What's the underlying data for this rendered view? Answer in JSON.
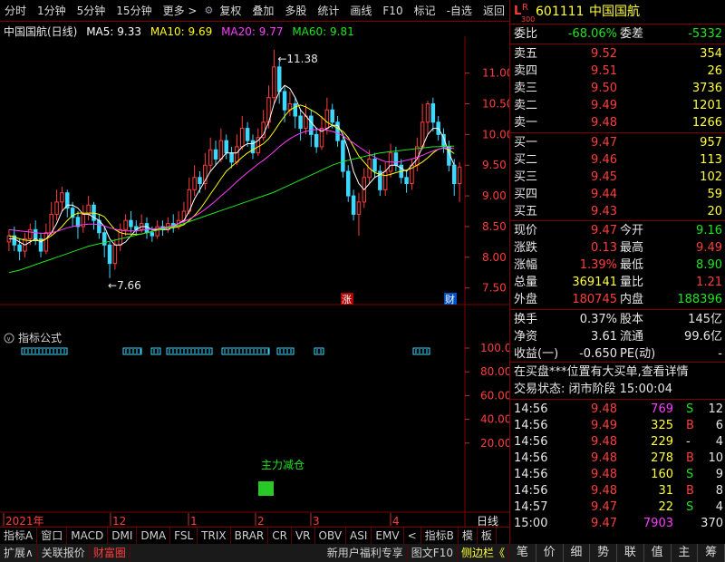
{
  "toolbar": {
    "left": [
      "分时",
      "1分钟",
      "5分钟",
      "15分钟",
      "更多 >"
    ],
    "right": [
      "复权",
      "叠加",
      "多股",
      "统计",
      "画线",
      "F10",
      "标记",
      "-自选",
      "返回"
    ]
  },
  "chart_header": {
    "name": "中国国航(日线)",
    "ma5": "MA5: 9.33",
    "ma10": "MA10: 9.69",
    "ma20": "MA20: 9.77",
    "ma60": "MA60: 9.81"
  },
  "colors": {
    "up": "#ff3c3c",
    "down": "#3cd8ff",
    "ma5": "#ffffff",
    "ma10": "#ffff00",
    "ma20": "#ff3cff",
    "ma60": "#1ee61e"
  },
  "chart_data": {
    "type": "candlestick",
    "y_ticks": [
      "11.00",
      "10.50",
      "10.00",
      "9.50",
      "9.00",
      "8.50",
      "8.00",
      "7.50"
    ],
    "ylim": [
      7.2,
      11.6
    ],
    "high_label": "11.38",
    "low_label": "7.66",
    "x_labels": [
      "2021年",
      "12",
      "1",
      "2",
      "3",
      "4"
    ],
    "candles": [
      [
        8.25,
        8.35,
        8.45,
        8.1
      ],
      [
        8.35,
        8.2,
        8.5,
        8.1
      ],
      [
        8.2,
        8.1,
        8.3,
        7.95
      ],
      [
        8.1,
        8.3,
        8.4,
        8.0
      ],
      [
        8.3,
        8.45,
        8.55,
        8.2
      ],
      [
        8.45,
        8.3,
        8.6,
        8.2
      ],
      [
        8.3,
        8.1,
        8.4,
        8.0
      ],
      [
        8.1,
        8.4,
        8.55,
        8.05
      ],
      [
        8.4,
        8.7,
        8.9,
        8.35
      ],
      [
        8.7,
        8.9,
        9.1,
        8.6
      ],
      [
        8.9,
        9.05,
        9.15,
        8.75
      ],
      [
        9.05,
        8.8,
        9.1,
        8.65
      ],
      [
        8.8,
        8.65,
        8.9,
        8.5
      ],
      [
        8.65,
        8.5,
        8.75,
        8.3
      ],
      [
        8.5,
        8.7,
        8.85,
        8.4
      ],
      [
        8.7,
        8.85,
        9.0,
        8.6
      ],
      [
        8.85,
        8.6,
        8.9,
        8.45
      ],
      [
        8.6,
        8.4,
        8.7,
        8.3
      ],
      [
        8.4,
        8.2,
        8.5,
        8.0
      ],
      [
        8.2,
        7.9,
        8.25,
        7.66
      ],
      [
        7.9,
        8.2,
        8.3,
        7.8
      ],
      [
        8.2,
        8.45,
        8.55,
        8.1
      ],
      [
        8.45,
        8.6,
        8.7,
        8.35
      ],
      [
        8.6,
        8.5,
        8.75,
        8.4
      ],
      [
        8.5,
        8.45,
        8.6,
        8.35
      ],
      [
        8.45,
        8.55,
        8.7,
        8.4
      ],
      [
        8.55,
        8.4,
        8.65,
        8.3
      ],
      [
        8.4,
        8.35,
        8.5,
        8.25
      ],
      [
        8.35,
        8.5,
        8.6,
        8.3
      ],
      [
        8.5,
        8.45,
        8.6,
        8.35
      ],
      [
        8.45,
        8.55,
        8.65,
        8.4
      ],
      [
        8.55,
        8.5,
        8.7,
        8.4
      ],
      [
        8.5,
        8.6,
        8.75,
        8.45
      ],
      [
        8.6,
        8.75,
        8.9,
        8.55
      ],
      [
        8.75,
        9.1,
        9.3,
        8.7
      ],
      [
        9.1,
        9.3,
        9.5,
        9.0
      ],
      [
        9.3,
        9.2,
        9.4,
        9.05
      ],
      [
        9.2,
        9.5,
        9.7,
        9.1
      ],
      [
        9.5,
        9.75,
        9.95,
        9.4
      ],
      [
        9.75,
        9.6,
        9.9,
        9.5
      ],
      [
        9.6,
        9.9,
        10.1,
        9.55
      ],
      [
        9.9,
        9.7,
        10.0,
        9.6
      ],
      [
        9.7,
        9.55,
        9.8,
        9.45
      ],
      [
        9.55,
        9.8,
        10.0,
        9.5
      ],
      [
        9.8,
        10.1,
        10.3,
        9.75
      ],
      [
        10.1,
        9.9,
        10.2,
        9.8
      ],
      [
        9.9,
        9.7,
        10.0,
        9.6
      ],
      [
        9.7,
        9.95,
        10.1,
        9.65
      ],
      [
        9.95,
        10.2,
        10.4,
        9.9
      ],
      [
        10.2,
        10.6,
        10.8,
        10.1
      ],
      [
        10.6,
        11.1,
        11.38,
        10.5
      ],
      [
        11.1,
        10.7,
        11.2,
        10.5
      ],
      [
        10.7,
        10.4,
        10.8,
        10.2
      ],
      [
        10.4,
        10.5,
        10.7,
        10.3
      ],
      [
        10.5,
        10.3,
        10.6,
        10.1
      ],
      [
        10.3,
        10.1,
        10.4,
        9.9
      ],
      [
        10.1,
        10.3,
        10.5,
        10.0
      ],
      [
        10.3,
        10.0,
        10.4,
        9.8
      ],
      [
        10.0,
        9.8,
        10.1,
        9.7
      ],
      [
        9.8,
        10.1,
        10.3,
        9.75
      ],
      [
        10.1,
        10.4,
        10.6,
        10.0
      ],
      [
        10.4,
        10.2,
        10.5,
        10.1
      ],
      [
        10.2,
        9.9,
        10.3,
        9.8
      ],
      [
        9.9,
        9.4,
        10.0,
        9.3
      ],
      [
        9.4,
        9.0,
        9.5,
        8.9
      ],
      [
        9.0,
        8.7,
        9.1,
        8.6
      ],
      [
        8.7,
        8.9,
        9.05,
        8.35
      ],
      [
        8.9,
        9.3,
        9.45,
        8.8
      ],
      [
        9.3,
        9.6,
        9.75,
        9.2
      ],
      [
        9.6,
        9.4,
        9.7,
        9.3
      ],
      [
        9.4,
        9.1,
        9.5,
        9.0
      ],
      [
        9.1,
        9.4,
        9.55,
        9.0
      ],
      [
        9.4,
        9.7,
        9.85,
        9.3
      ],
      [
        9.7,
        9.5,
        9.8,
        9.4
      ],
      [
        9.5,
        9.3,
        9.6,
        9.2
      ],
      [
        9.3,
        9.2,
        9.4,
        9.05
      ],
      [
        9.2,
        9.5,
        9.6,
        9.1
      ],
      [
        9.5,
        9.8,
        9.95,
        9.4
      ],
      [
        9.8,
        10.2,
        10.5,
        9.75
      ],
      [
        10.2,
        10.5,
        10.55,
        10.0
      ],
      [
        10.5,
        10.2,
        10.6,
        10.05
      ],
      [
        10.2,
        10.0,
        10.3,
        9.9
      ],
      [
        10.0,
        9.8,
        10.1,
        9.7
      ],
      [
        9.8,
        9.5,
        9.9,
        9.4
      ],
      [
        9.5,
        9.2,
        9.6,
        9.0
      ],
      [
        9.2,
        9.47,
        9.55,
        8.9
      ]
    ],
    "series": [
      {
        "name": "MA5",
        "values": [
          8.3,
          8.3,
          8.25,
          8.2,
          8.25,
          8.3,
          8.25,
          8.3,
          8.4,
          8.55,
          8.75,
          8.85,
          8.85,
          8.8,
          8.7,
          8.7,
          8.65,
          8.6,
          8.5,
          8.3,
          8.2,
          8.2,
          8.25,
          8.35,
          8.45,
          8.5,
          8.5,
          8.45,
          8.45,
          8.45,
          8.45,
          8.5,
          8.55,
          8.6,
          8.75,
          8.95,
          9.1,
          9.25,
          9.4,
          9.5,
          9.6,
          9.7,
          9.7,
          9.7,
          9.8,
          9.85,
          9.85,
          9.9,
          10.0,
          10.2,
          10.5,
          10.7,
          10.8,
          10.75,
          10.6,
          10.4,
          10.3,
          10.2,
          10.1,
          10.05,
          10.1,
          10.15,
          10.15,
          10.0,
          9.75,
          9.4,
          9.2,
          9.1,
          9.2,
          9.3,
          9.35,
          9.4,
          9.5,
          9.5,
          9.45,
          9.4,
          9.5,
          9.6,
          9.8,
          10.0,
          10.1,
          10.1,
          9.95,
          9.7,
          9.5
        ]
      },
      {
        "name": "MA10",
        "values": [
          8.35,
          8.33,
          8.3,
          8.28,
          8.27,
          8.27,
          8.27,
          8.3,
          8.35,
          8.42,
          8.5,
          8.6,
          8.68,
          8.72,
          8.72,
          8.72,
          8.72,
          8.7,
          8.66,
          8.55,
          8.45,
          8.4,
          8.38,
          8.38,
          8.37,
          8.38,
          8.4,
          8.42,
          8.45,
          8.47,
          8.48,
          8.48,
          8.5,
          8.53,
          8.6,
          8.68,
          8.78,
          8.9,
          9.03,
          9.15,
          9.28,
          9.4,
          9.48,
          9.55,
          9.63,
          9.7,
          9.75,
          9.8,
          9.85,
          9.93,
          10.05,
          10.18,
          10.3,
          10.4,
          10.45,
          10.48,
          10.45,
          10.4,
          10.35,
          10.28,
          10.2,
          10.15,
          10.1,
          10.05,
          9.95,
          9.8,
          9.65,
          9.55,
          9.45,
          9.38,
          9.35,
          9.33,
          9.35,
          9.38,
          9.4,
          9.42,
          9.45,
          9.5,
          9.55,
          9.62,
          9.7,
          9.76,
          9.78,
          9.75,
          9.69
        ]
      },
      {
        "name": "MA20",
        "values": [
          8.45,
          8.44,
          8.43,
          8.42,
          8.41,
          8.4,
          8.39,
          8.39,
          8.4,
          8.42,
          8.45,
          8.48,
          8.5,
          8.52,
          8.53,
          8.54,
          8.54,
          8.53,
          8.51,
          8.48,
          8.46,
          8.44,
          8.43,
          8.43,
          8.43,
          8.44,
          8.45,
          8.46,
          8.47,
          8.48,
          8.5,
          8.52,
          8.55,
          8.58,
          8.62,
          8.67,
          8.72,
          8.78,
          8.85,
          8.92,
          9.0,
          9.07,
          9.15,
          9.23,
          9.31,
          9.38,
          9.45,
          9.52,
          9.58,
          9.65,
          9.72,
          9.8,
          9.87,
          9.93,
          9.98,
          10.02,
          10.05,
          10.07,
          10.08,
          10.08,
          10.07,
          10.05,
          10.02,
          9.98,
          9.92,
          9.86,
          9.8,
          9.74,
          9.68,
          9.63,
          9.59,
          9.56,
          9.55,
          9.55,
          9.56,
          9.58,
          9.6,
          9.63,
          9.66,
          9.7,
          9.73,
          9.76,
          9.78,
          9.78,
          9.77
        ]
      },
      {
        "name": "MA60",
        "values": [
          7.75,
          7.77,
          7.79,
          7.82,
          7.85,
          7.88,
          7.91,
          7.94,
          7.97,
          8.0,
          8.03,
          8.06,
          8.09,
          8.12,
          8.15,
          8.18,
          8.2,
          8.22,
          8.24,
          8.26,
          8.28,
          8.3,
          8.32,
          8.34,
          8.36,
          8.38,
          8.4,
          8.42,
          8.44,
          8.46,
          8.48,
          8.5,
          8.52,
          8.55,
          8.58,
          8.61,
          8.64,
          8.67,
          8.7,
          8.73,
          8.76,
          8.79,
          8.82,
          8.85,
          8.88,
          8.91,
          8.94,
          8.97,
          9.0,
          9.03,
          9.06,
          9.1,
          9.14,
          9.18,
          9.22,
          9.26,
          9.3,
          9.34,
          9.38,
          9.42,
          9.46,
          9.5,
          9.53,
          9.56,
          9.58,
          9.6,
          9.62,
          9.64,
          9.66,
          9.68,
          9.7,
          9.71,
          9.72,
          9.73,
          9.74,
          9.75,
          9.76,
          9.77,
          9.78,
          9.79,
          9.8,
          9.8,
          9.81,
          9.81,
          9.81
        ]
      }
    ]
  },
  "markers": {
    "zhang": "涨",
    "cai": "财"
  },
  "indicator": {
    "title": "指标公式",
    "y_ticks": [
      "100.00",
      "80.00",
      "60.00",
      "40.00",
      "20.00"
    ],
    "label": "主力减仓"
  },
  "bottom_row1": [
    "指标A",
    "窗口",
    "MACD",
    "DMI",
    "DMA",
    "FSL",
    "TRIX",
    "BRAR",
    "CR",
    "VR",
    "OBV",
    "ASI",
    "EMV",
    "<",
    "指标B",
    "模",
    "板"
  ],
  "bottom_row2_left": [
    "扩展∧",
    "关联报价",
    "财富圈"
  ],
  "bottom_row2_right": [
    "新用户福利专享",
    "图文F10",
    "侧边栏《"
  ],
  "period": "日线",
  "quote": {
    "L": "L",
    "R": "R",
    "r_sub": "300",
    "code": "601111",
    "name": "中国国航",
    "weibi_label": "委比",
    "weibi": "-68.06%",
    "weicha_label": "委差",
    "weicha": "-5332",
    "sells": [
      {
        "label": "卖五",
        "price": "9.52",
        "vol": "354"
      },
      {
        "label": "卖四",
        "price": "9.51",
        "vol": "26"
      },
      {
        "label": "卖三",
        "price": "9.50",
        "vol": "3736"
      },
      {
        "label": "卖二",
        "price": "9.49",
        "vol": "1201"
      },
      {
        "label": "卖一",
        "price": "9.48",
        "vol": "1266"
      }
    ],
    "buys": [
      {
        "label": "买一",
        "price": "9.47",
        "vol": "957"
      },
      {
        "label": "买二",
        "price": "9.46",
        "vol": "113"
      },
      {
        "label": "买三",
        "price": "9.45",
        "vol": "102"
      },
      {
        "label": "买四",
        "price": "9.44",
        "vol": "59"
      },
      {
        "label": "买五",
        "price": "9.43",
        "vol": "20"
      }
    ],
    "stats": [
      {
        "l1": "现价",
        "v1": "9.47",
        "c1": "red",
        "l2": "今开",
        "v2": "9.16",
        "c2": "green"
      },
      {
        "l1": "涨跌",
        "v1": "0.13",
        "c1": "red",
        "l2": "最高",
        "v2": "9.49",
        "c2": "red"
      },
      {
        "l1": "涨幅",
        "v1": "1.39%",
        "c1": "red",
        "l2": "最低",
        "v2": "8.90",
        "c2": "green"
      },
      {
        "l1": "总量",
        "v1": "369141",
        "c1": "yellow",
        "l2": "量比",
        "v2": "1.21",
        "c2": "red"
      },
      {
        "l1": "外盘",
        "v1": "180745",
        "c1": "red",
        "l2": "内盘",
        "v2": "188396",
        "c2": "green"
      }
    ],
    "stats2": [
      {
        "l1": "换手",
        "v1": "0.37%",
        "l2": "股本",
        "v2": "145亿"
      },
      {
        "l1": "净资",
        "v1": "3.61",
        "l2": "流通",
        "v2": "99.6亿"
      },
      {
        "l1": "收益(一)",
        "v1": "-0.650",
        "l2": "PE(动)",
        "v2": "-"
      }
    ],
    "notice": "在买盘***位置有大买单,查看详情",
    "status": "交易状态: 闭市阶段 15:00:04",
    "ticks": [
      {
        "t": "14:56",
        "p": "9.48",
        "v": "769",
        "vc": "mag",
        "bs": "S",
        "bc": "green",
        "n": "12"
      },
      {
        "t": "14:56",
        "p": "9.49",
        "v": "325",
        "vc": "yellow",
        "bs": "B",
        "bc": "red",
        "n": "6"
      },
      {
        "t": "14:56",
        "p": "9.48",
        "v": "229",
        "vc": "yellow",
        "bs": "-",
        "bc": "white",
        "n": "4"
      },
      {
        "t": "14:56",
        "p": "9.48",
        "v": "278",
        "vc": "yellow",
        "bs": "B",
        "bc": "red",
        "n": "10"
      },
      {
        "t": "14:56",
        "p": "9.48",
        "v": "160",
        "vc": "yellow",
        "bs": "S",
        "bc": "green",
        "n": "9"
      },
      {
        "t": "14:56",
        "p": "9.48",
        "v": "31",
        "vc": "yellow",
        "bs": "B",
        "bc": "red",
        "n": "8"
      },
      {
        "t": "14:57",
        "p": "9.47",
        "v": "22",
        "vc": "yellow",
        "bs": "S",
        "bc": "green",
        "n": "4"
      },
      {
        "t": "15:00",
        "p": "9.47",
        "v": "7903",
        "vc": "mag",
        "bs": "",
        "bc": "white",
        "n": "370"
      }
    ]
  },
  "bottom_right_tabs": [
    "笔",
    "价",
    "细",
    "势",
    "联",
    "值",
    "主",
    "筹"
  ]
}
